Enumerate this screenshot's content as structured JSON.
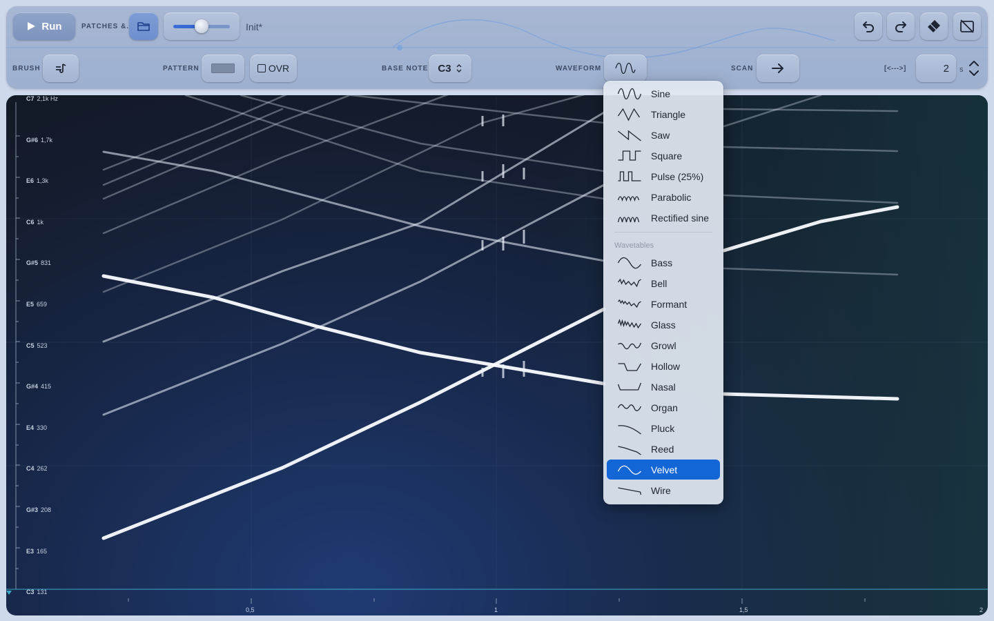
{
  "toolbar": {
    "run_label": "Run",
    "patches_label": "PATCHES &.",
    "patch_name": "Init*",
    "brush_label": "BRUSH",
    "pattern_label": "PATTERN",
    "ovr_label": "OVR",
    "base_note_label": "BASE NOTE",
    "base_note_value": "C3",
    "waveform_label": "WAVEFORM",
    "scan_label": "SCAN",
    "range_label": "[<--->]",
    "duration_value": "2",
    "duration_unit": "s",
    "volume_level": 0.5
  },
  "canvas": {
    "note_labels": [
      {
        "note": "C7",
        "freq": "2,1k Hz"
      },
      {
        "note": "G#6",
        "freq": "1,7k"
      },
      {
        "note": "E6",
        "freq": "1,3k"
      },
      {
        "note": "C6",
        "freq": "1k"
      },
      {
        "note": "G#5",
        "freq": "831"
      },
      {
        "note": "E5",
        "freq": "659"
      },
      {
        "note": "C5",
        "freq": "523"
      },
      {
        "note": "G#4",
        "freq": "415"
      },
      {
        "note": "E4",
        "freq": "330"
      },
      {
        "note": "C4",
        "freq": "262"
      },
      {
        "note": "G#3",
        "freq": "208"
      },
      {
        "note": "E3",
        "freq": "165"
      },
      {
        "note": "C3",
        "freq": "131"
      }
    ],
    "time_labels": [
      "0,5",
      "1",
      "1,5",
      "2"
    ]
  },
  "waveform_menu": {
    "basic": [
      {
        "label": "Sine",
        "icon": "sine-wave-icon"
      },
      {
        "label": "Triangle",
        "icon": "triangle-wave-icon"
      },
      {
        "label": "Saw",
        "icon": "saw-wave-icon"
      },
      {
        "label": "Square",
        "icon": "square-wave-icon"
      },
      {
        "label": "Pulse (25%)",
        "icon": "pulse-wave-icon"
      },
      {
        "label": "Parabolic",
        "icon": "parabolic-wave-icon"
      },
      {
        "label": "Rectified sine",
        "icon": "rectified-sine-icon"
      }
    ],
    "section_title": "Wavetables",
    "wavetables": [
      {
        "label": "Bass",
        "icon": "bass-wave-icon"
      },
      {
        "label": "Bell",
        "icon": "bell-wave-icon"
      },
      {
        "label": "Formant",
        "icon": "formant-wave-icon"
      },
      {
        "label": "Glass",
        "icon": "glass-wave-icon"
      },
      {
        "label": "Growl",
        "icon": "growl-wave-icon"
      },
      {
        "label": "Hollow",
        "icon": "hollow-wave-icon"
      },
      {
        "label": "Nasal",
        "icon": "nasal-wave-icon"
      },
      {
        "label": "Organ",
        "icon": "organ-wave-icon"
      },
      {
        "label": "Pluck",
        "icon": "pluck-wave-icon"
      },
      {
        "label": "Reed",
        "icon": "reed-wave-icon"
      },
      {
        "label": "Velvet",
        "icon": "velvet-wave-icon"
      },
      {
        "label": "Wire",
        "icon": "wire-wave-icon"
      }
    ],
    "selected": "Velvet"
  },
  "colors": {
    "accent": "#1266d6",
    "selected_row": "#1266d6"
  }
}
